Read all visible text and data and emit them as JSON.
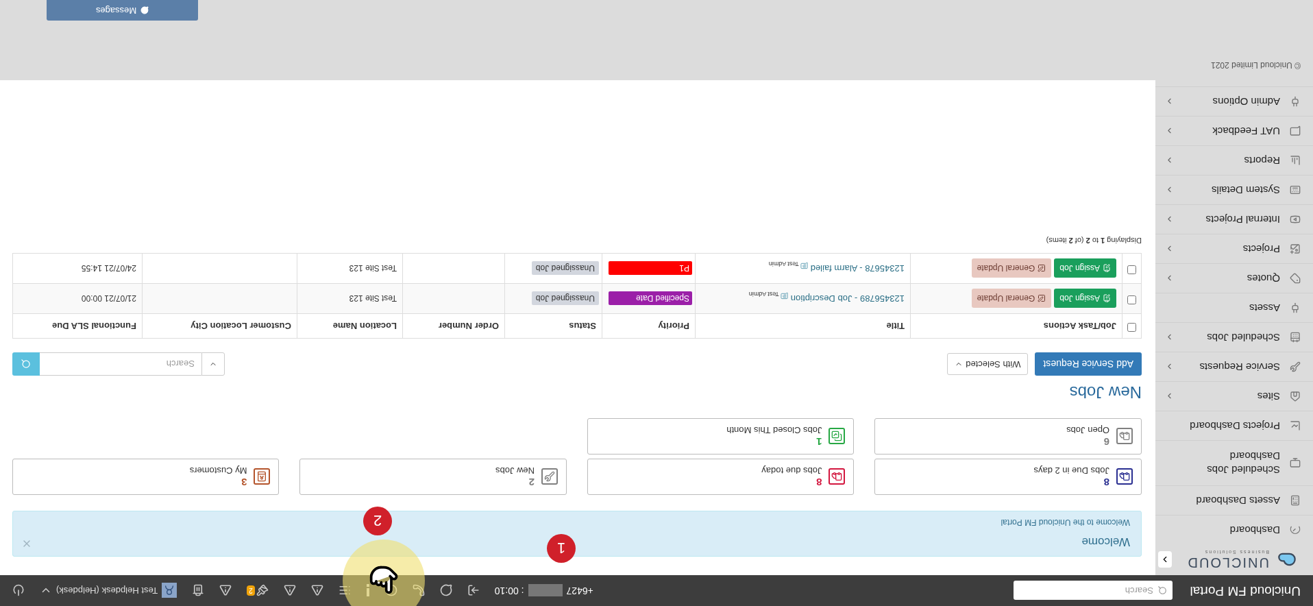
{
  "header": {
    "title": "Unicloud FM Portal",
    "search": {
      "placeholder": "Search"
    },
    "call": {
      "number": "+6427",
      "timer": ": 00:10"
    },
    "badge": "2",
    "user": "Test Helpdesk (Helpdesk)"
  },
  "logo": {
    "name": "UNICLOUD",
    "tagline": "Business Solutions"
  },
  "sidebar": {
    "items": [
      {
        "label": "Dashboard",
        "expandable": false
      },
      {
        "label": "Assets Dashboard",
        "expandable": false
      },
      {
        "label": "Scheduled Jobs Dashboard",
        "expandable": false
      },
      {
        "label": "Projects Dashboard",
        "expandable": false
      },
      {
        "label": "Sites",
        "expandable": true
      },
      {
        "label": "Service Requests",
        "expandable": true
      },
      {
        "label": "Scheduled Jobs",
        "expandable": true
      },
      {
        "label": "Assets",
        "expandable": false
      },
      {
        "label": "Quotes",
        "expandable": true
      },
      {
        "label": "Projects",
        "expandable": true
      },
      {
        "label": "Internal Projects",
        "expandable": true
      },
      {
        "label": "System Details",
        "expandable": true
      },
      {
        "label": "Reports",
        "expandable": true
      },
      {
        "label": "UAT Feedback",
        "expandable": true
      },
      {
        "label": "Admin Options",
        "expandable": true
      }
    ]
  },
  "alert": {
    "title": "Welcome",
    "message": "Welcome to the Unicloud FM Portal"
  },
  "stat_cards": [
    {
      "value": "8",
      "label": "Jobs Due in 2 days",
      "color": "#2a2f91"
    },
    {
      "value": "8",
      "label": "Jobs due today",
      "color": "#d3173f"
    },
    {
      "value": "2",
      "label": "New Jobs",
      "color": "#808080"
    },
    {
      "value": "3",
      "label": "My Customers",
      "color": "#b4542b"
    },
    {
      "value": "6",
      "label": "Open Jobs",
      "color": "#808080"
    },
    {
      "value": "1",
      "label": "Jobs Closed This Month",
      "color": "#27a844"
    }
  ],
  "section_title": "New Jobs",
  "toolbar": {
    "add_button": "Add Service Request",
    "bulk_menu": "With Selected",
    "search": {
      "placeholder": "Search"
    }
  },
  "table": {
    "columns": [
      "Job/Task Actions",
      "Title",
      "Priority",
      "Status",
      "Order Number",
      "Location Name",
      "Customer Location City",
      "Functional SLA Due"
    ],
    "all_selected": false,
    "rows": [
      {
        "selected": false,
        "actions": [
          "Assign Job",
          "General Update"
        ],
        "title": "123456789 - Job Description",
        "author": "Test Admin",
        "priority": {
          "text": "Specified Date",
          "color": "#9b1fa8"
        },
        "status": "Unassigned Job",
        "location": "Test Site 123",
        "sla_due": "21/07/21 00:00"
      },
      {
        "selected": false,
        "actions": [
          "Assign Job",
          "General Update"
        ],
        "title": "12345678 - Alarm failed",
        "author": "Test Admin",
        "priority": {
          "text": "P1",
          "color": "#ff0000"
        },
        "status": "Unassigned Job",
        "location": "Test Site 123",
        "sla_due": "24/07/21 14:55"
      }
    ]
  },
  "pagination": "Displaying **1** to **2** (of **2** items)",
  "footer": {
    "copyright": "© Unicloud Limited 2021"
  },
  "messages_button": "Messages",
  "tour_markers": [
    "1",
    "2"
  ]
}
